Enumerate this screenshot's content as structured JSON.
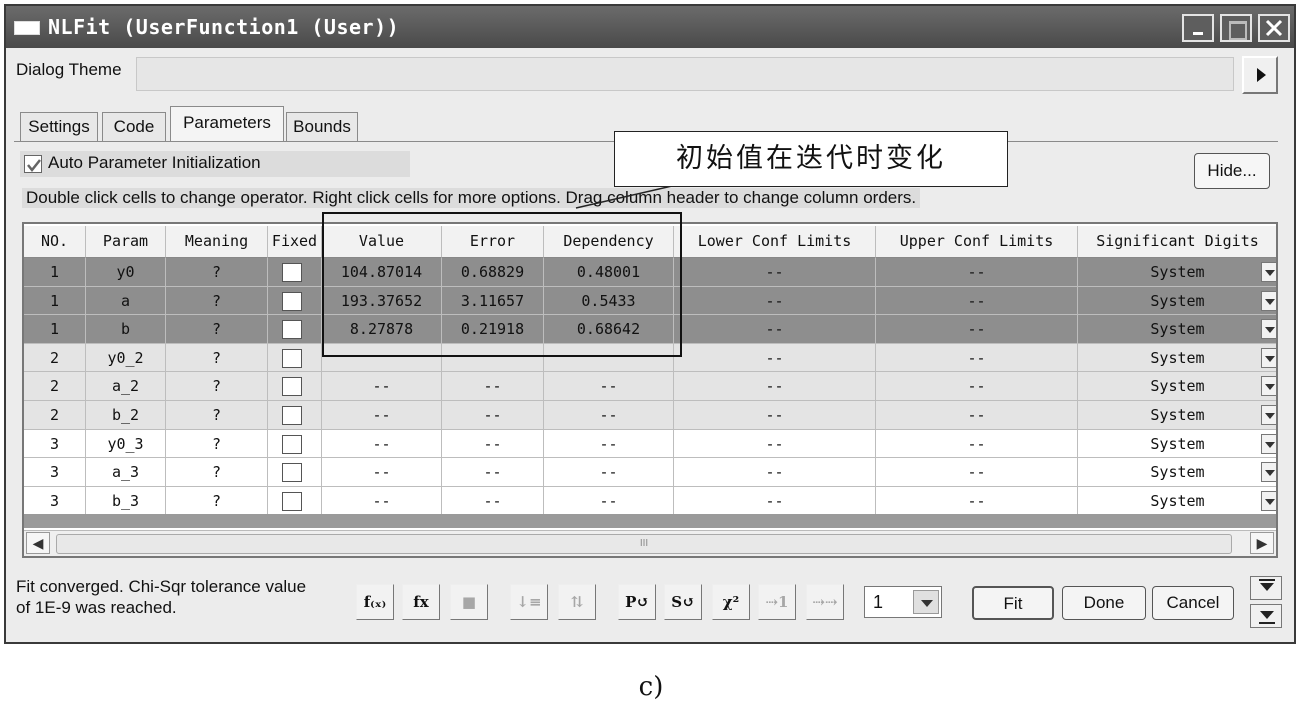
{
  "window": {
    "title": "NLFit (UserFunction1 (User))"
  },
  "theme": {
    "label": "Dialog Theme",
    "value": ""
  },
  "tabs": [
    {
      "label": "Settings"
    },
    {
      "label": "Code"
    },
    {
      "label": "Parameters",
      "active": true
    },
    {
      "label": "Bounds"
    }
  ],
  "params_panel": {
    "auto_init_label": "Auto Parameter Initialization",
    "auto_init_checked": true,
    "hide_label": "Hide...",
    "info": "Double click cells to change operator. Right click cells for more options. Drag column header to change column orders."
  },
  "annotation": {
    "text": "初始值在迭代时变化"
  },
  "table": {
    "headers": [
      "NO.",
      "Param",
      "Meaning",
      "Fixed",
      "Value",
      "Error",
      "Dependency",
      "Lower Conf Limits",
      "Upper Conf Limits",
      "Significant Digits"
    ],
    "rows": [
      {
        "no": "1",
        "param": "y0",
        "meaning": "?",
        "value": "104.87014",
        "error": "0.68829",
        "dependency": "0.48001",
        "lower": "--",
        "upper": "--",
        "digits": "System"
      },
      {
        "no": "1",
        "param": "a",
        "meaning": "?",
        "value": "193.37652",
        "error": "3.11657",
        "dependency": "0.5433",
        "lower": "--",
        "upper": "--",
        "digits": "System"
      },
      {
        "no": "1",
        "param": "b",
        "meaning": "?",
        "value": "8.27878",
        "error": "0.21918",
        "dependency": "0.68642",
        "lower": "--",
        "upper": "--",
        "digits": "System"
      },
      {
        "no": "2",
        "param": "y0_2",
        "meaning": "?",
        "value": "",
        "error": "",
        "dependency": "",
        "lower": "--",
        "upper": "--",
        "digits": "System"
      },
      {
        "no": "2",
        "param": "a_2",
        "meaning": "?",
        "value": "--",
        "error": "--",
        "dependency": "--",
        "lower": "--",
        "upper": "--",
        "digits": "System"
      },
      {
        "no": "2",
        "param": "b_2",
        "meaning": "?",
        "value": "--",
        "error": "--",
        "dependency": "--",
        "lower": "--",
        "upper": "--",
        "digits": "System"
      },
      {
        "no": "3",
        "param": "y0_3",
        "meaning": "?",
        "value": "--",
        "error": "--",
        "dependency": "--",
        "lower": "--",
        "upper": "--",
        "digits": "System"
      },
      {
        "no": "3",
        "param": "a_3",
        "meaning": "?",
        "value": "--",
        "error": "--",
        "dependency": "--",
        "lower": "--",
        "upper": "--",
        "digits": "System"
      },
      {
        "no": "3",
        "param": "b_3",
        "meaning": "?",
        "value": "--",
        "error": "--",
        "dependency": "--",
        "lower": "--",
        "upper": "--",
        "digits": "System"
      }
    ],
    "scroll_thumb_label": "III"
  },
  "status": {
    "line1": "Fit converged. Chi-Sqr tolerance value",
    "line2": "of 1E-9 was reached."
  },
  "toolbar": {
    "icons": [
      {
        "name": "fx0-icon",
        "glyph": "f₍ₓ₎",
        "enabled": true
      },
      {
        "name": "fx-icon",
        "glyph": "fx",
        "enabled": true
      },
      {
        "name": "save-icon",
        "glyph": "■",
        "enabled": false
      },
      {
        "name": "sort-down-icon",
        "glyph": "↓≡",
        "enabled": false
      },
      {
        "name": "sort-updown-icon",
        "glyph": "⇅",
        "enabled": false
      },
      {
        "name": "param-reset-icon",
        "glyph": "P↺",
        "enabled": true
      },
      {
        "name": "s-reset-icon",
        "glyph": "S↺",
        "enabled": true
      },
      {
        "name": "chi-square-icon",
        "glyph": "χ²",
        "enabled": true
      },
      {
        "name": "iterate-one-icon",
        "glyph": "⇢1",
        "enabled": false
      },
      {
        "name": "iterate-all-icon",
        "glyph": "⇢⇢",
        "enabled": false
      }
    ],
    "iteration_value": "1"
  },
  "buttons": {
    "fit": "Fit",
    "done": "Done",
    "cancel": "Cancel"
  },
  "caption": "c)",
  "colors": {
    "selected_row": "#8e8e8e",
    "group2_row": "#e4e4e4",
    "group3_row": "#ffffff"
  }
}
